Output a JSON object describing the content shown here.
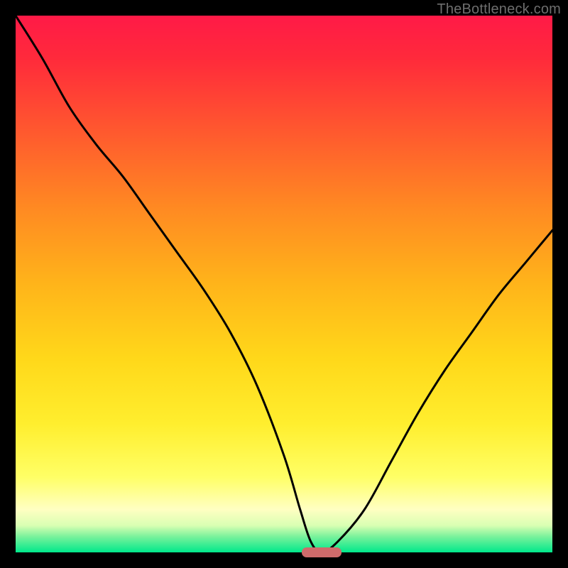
{
  "watermark": "TheBottleneck.com",
  "colors": {
    "frame": "#000000",
    "gradient_top": "#ff1a47",
    "gradient_mid": "#ffd81a",
    "gradient_bottom": "#00e88b",
    "curve": "#000000",
    "marker": "#cf6b6b"
  },
  "chart_data": {
    "type": "line",
    "title": "",
    "xlabel": "",
    "ylabel": "",
    "xlim": [
      0,
      100
    ],
    "ylim": [
      0,
      100
    ],
    "grid": false,
    "legend": false,
    "series": [
      {
        "name": "bottleneck-curve",
        "x": [
          0,
          5,
          10,
          15,
          20,
          25,
          30,
          35,
          40,
          45,
          50,
          53,
          55,
          57,
          60,
          65,
          70,
          75,
          80,
          85,
          90,
          95,
          100
        ],
        "values": [
          100,
          92,
          83,
          76,
          70,
          63,
          56,
          49,
          41,
          31,
          18,
          8,
          2,
          0,
          2,
          8,
          17,
          26,
          34,
          41,
          48,
          54,
          60
        ]
      }
    ],
    "annotations": [
      {
        "name": "optimal-marker",
        "x": 57,
        "y": 0,
        "width_pct": 7.4,
        "height_pct": 1.8
      }
    ]
  }
}
